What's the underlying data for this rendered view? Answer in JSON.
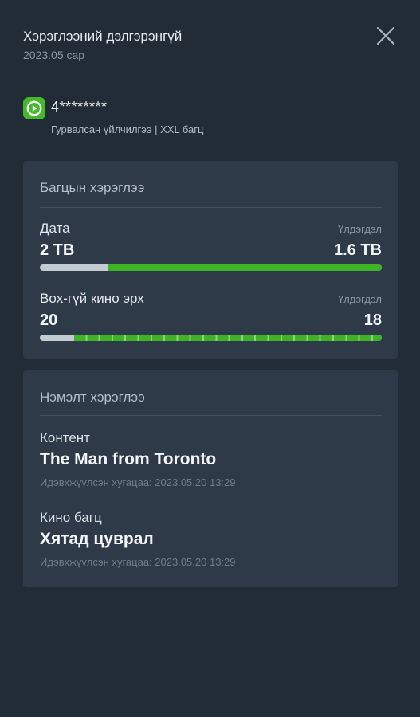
{
  "header": {
    "title": "Хэрэглээний дэлгэрэнгүй",
    "subtitle": "2023.05 сар"
  },
  "account": {
    "number": "4********",
    "description": "Гурвалсан үйлчилгээ | XXL багц",
    "logo_icon": "play-logo-icon",
    "logo_color": "#46b92a"
  },
  "package_usage": {
    "title": "Багцын хэрэглээ",
    "items": [
      {
        "label": "Дата",
        "remaining_label": "Үлдэгдэл",
        "total": "2 TB",
        "remaining": "1.6 TB",
        "remaining_fraction": 0.8
      },
      {
        "label": "Box-гүй кино эрх",
        "remaining_label": "Үлдэгдэл",
        "total": "20",
        "remaining": "18",
        "remaining_fraction": 0.9
      }
    ]
  },
  "extra_usage": {
    "title": "Нэмэлт хэрэглээ",
    "items": [
      {
        "label": "Контент",
        "title": "The Man from Toronto",
        "activated": "Идэвхжүүлсэн хугацаа: 2023.05.20 13:29"
      },
      {
        "label": "Кино багц",
        "title": "Хятад цуврал",
        "activated": "Идэвхжүүлсэн хугацаа: 2023.05.20 13:29"
      }
    ]
  },
  "colors": {
    "background": "#222c36",
    "card": "#2e3a47",
    "accent_green": "#3db426",
    "bar_used": "#c2cad2"
  }
}
